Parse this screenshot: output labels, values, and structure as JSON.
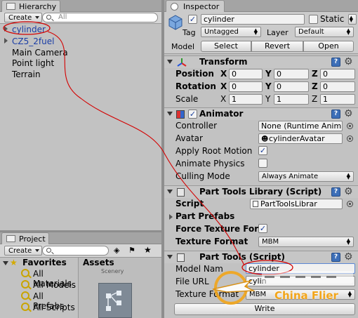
{
  "hierarchy": {
    "tab_label": "Hierarchy",
    "create_label": "Create",
    "search_placeholder": "All",
    "items": [
      "cylinder",
      "CZ5_2fuel",
      "Main Camera",
      "Point light",
      "Terrain"
    ]
  },
  "project": {
    "tab_label": "Project",
    "create_label": "Create",
    "favorites_label": "Favorites",
    "favorites": [
      "All Materials",
      "All Models",
      "All Prefabs",
      "All Scripts"
    ],
    "assets_label": "Assets",
    "asset_partial_label": "Scenery"
  },
  "inspector": {
    "tab_label": "Inspector",
    "object_name": "cylinder",
    "static_label": "Static",
    "tag_label": "Tag",
    "tag_value": "Untagged",
    "layer_label": "Layer",
    "layer_value": "Default",
    "model_label": "Model",
    "model_buttons": [
      "Select",
      "Revert",
      "Open"
    ],
    "transform": {
      "title": "Transform",
      "position_label": "Position",
      "rotation_label": "Rotation",
      "scale_label": "Scale",
      "axis_x": "X",
      "axis_y": "Y",
      "axis_z": "Z",
      "position": [
        "0",
        "0",
        "0"
      ],
      "rotation": [
        "0",
        "0",
        "0"
      ],
      "scale": [
        "1",
        "1",
        "1"
      ]
    },
    "animator": {
      "title": "Animator",
      "controller_label": "Controller",
      "controller_value": "None (Runtime Anim",
      "avatar_label": "Avatar",
      "avatar_value": "cylinderAvatar",
      "apply_root_motion_label": "Apply Root Motion",
      "animate_physics_label": "Animate Physics",
      "culling_mode_label": "Culling Mode",
      "culling_mode_value": "Always Animate"
    },
    "library": {
      "title": "Part Tools Library (Script)",
      "script_label": "Script",
      "script_value": "PartToolsLibrar",
      "part_prefabs_label": "Part Prefabs",
      "force_texture_label": "Force Texture For",
      "texture_format_label": "Texture Format",
      "texture_format_value": "MBM"
    },
    "parttools": {
      "title": "Part Tools (Script)",
      "model_name_label": "Model Nam",
      "model_name_value": "cylinder",
      "file_url_label": "File URL",
      "file_url_value": "cylin",
      "texture_format_label": "Texture Format",
      "texture_format_value": "MBM",
      "write_label": "Write"
    }
  },
  "watermark": {
    "text": "China Flier"
  },
  "colors": {
    "annotation": "#d40000",
    "selected_text": "#1b3ea6",
    "accent": "#3d6fb8"
  }
}
